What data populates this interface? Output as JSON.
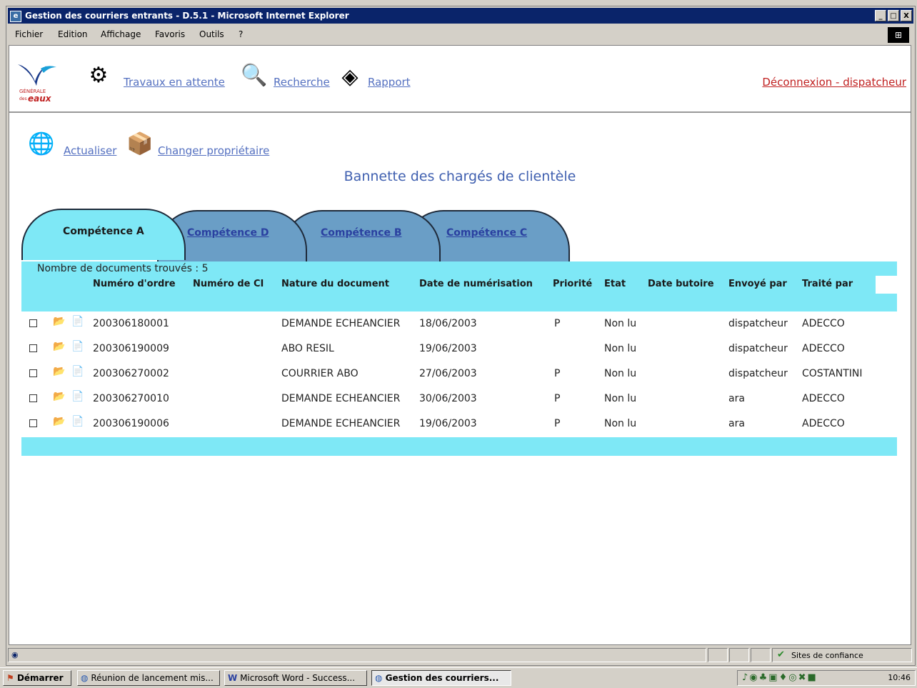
{
  "window": {
    "title": "Gestion des courriers entrants - D.5.1 - Microsoft Internet Explorer",
    "buttons": {
      "minimize": "_",
      "maximize": "□",
      "close": "X"
    }
  },
  "menu": [
    "Fichier",
    "Edition",
    "Affichage",
    "Favoris",
    "Outils",
    "?"
  ],
  "nav": {
    "logo_text_1": "GÉNÉRALE",
    "logo_text_2": "des",
    "logo_text_3": "eaux",
    "links": [
      "Travaux en attente",
      "Recherche",
      "Rapport"
    ],
    "logout": "Déconnexion - dispatcheur"
  },
  "actions": [
    "Actualiser",
    "Changer propriétaire"
  ],
  "page_title": "Bannette des chargés de clientèle",
  "tabs": [
    "Compétence A",
    "Compétence D",
    "Compétence B",
    "Compétence C"
  ],
  "active_tab": "Compétence A",
  "grid": {
    "count_label": "Nombre de documents trouvés : 5",
    "columns": [
      "Numéro d'ordre",
      "Numéro de CI",
      "Nature du document",
      "Date de numérisation",
      "Priorité",
      "Etat",
      "Date butoire",
      "Envoyé par",
      "Traité par"
    ],
    "rows": [
      {
        "numero": "200306180001",
        "ci": "",
        "nature": "DEMANDE ECHEANCIER",
        "date": "18/06/2003",
        "priorite": "P",
        "etat": "Non lu",
        "butoire": "",
        "envoye": "dispatcheur",
        "traite": "ADECCO"
      },
      {
        "numero": "200306190009",
        "ci": "",
        "nature": "ABO RESIL",
        "date": "19/06/2003",
        "priorite": "",
        "etat": "Non lu",
        "butoire": "",
        "envoye": "dispatcheur",
        "traite": "ADECCO"
      },
      {
        "numero": "200306270002",
        "ci": "",
        "nature": "COURRIER ABO",
        "date": "27/06/2003",
        "priorite": "P",
        "etat": "Non lu",
        "butoire": "",
        "envoye": "dispatcheur",
        "traite": "COSTANTINI"
      },
      {
        "numero": "200306270010",
        "ci": "",
        "nature": "DEMANDE ECHEANCIER",
        "date": "30/06/2003",
        "priorite": "P",
        "etat": "Non lu",
        "butoire": "",
        "envoye": "ara",
        "traite": "ADECCO"
      },
      {
        "numero": "200306190006",
        "ci": "",
        "nature": "DEMANDE ECHEANCIER",
        "date": "19/06/2003",
        "priorite": "P",
        "etat": "Non lu",
        "butoire": "",
        "envoye": "ara",
        "traite": "ADECCO"
      }
    ]
  },
  "status": {
    "zone": "Sites de confiance"
  },
  "taskbar": {
    "start": "Démarrer",
    "tasks": [
      "Réunion de lancement mis...",
      "Microsoft Word - Success...",
      "Gestion des courriers..."
    ],
    "clock": "10:46"
  }
}
